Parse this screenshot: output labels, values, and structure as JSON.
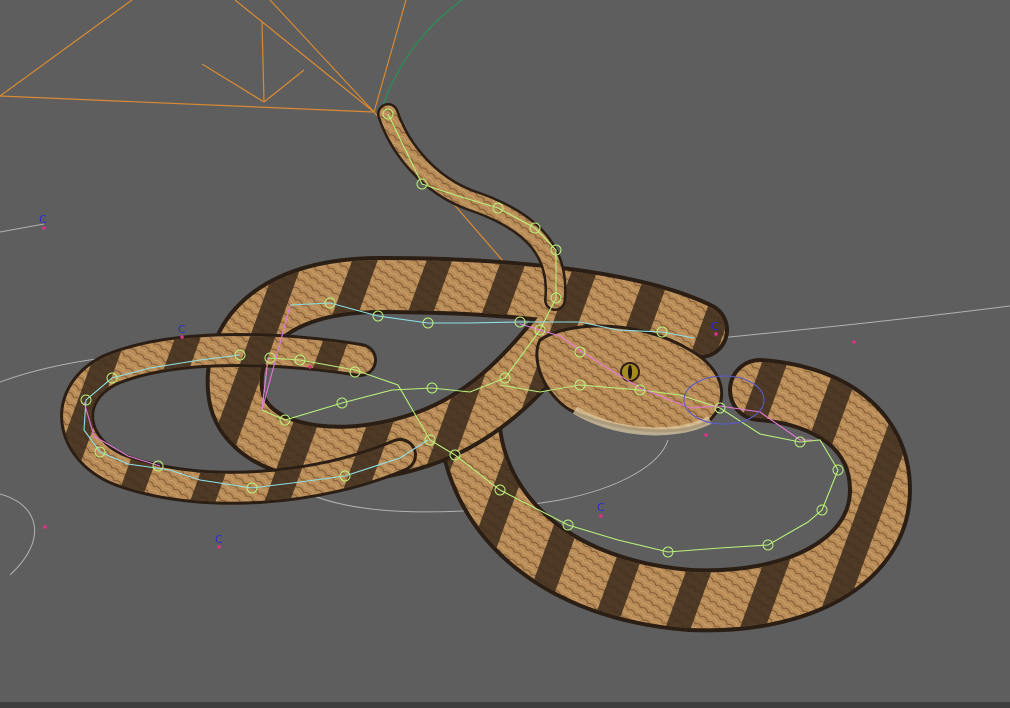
{
  "viewport": {
    "background": "#5e5e5e",
    "scene_object": "snake",
    "helper_label": "C",
    "colors": {
      "camera_frustum": "#d98a32",
      "spline_path": "#bfbfbf",
      "rig_green": "#b8f07a",
      "rig_cyan": "#8ce0e8",
      "rig_pink": "#e278d8",
      "helper_dot": "#e0308a",
      "helper_label": "#2a2ad6",
      "snake_light": "#c79a62",
      "snake_dark": "#3b2a1c"
    }
  }
}
